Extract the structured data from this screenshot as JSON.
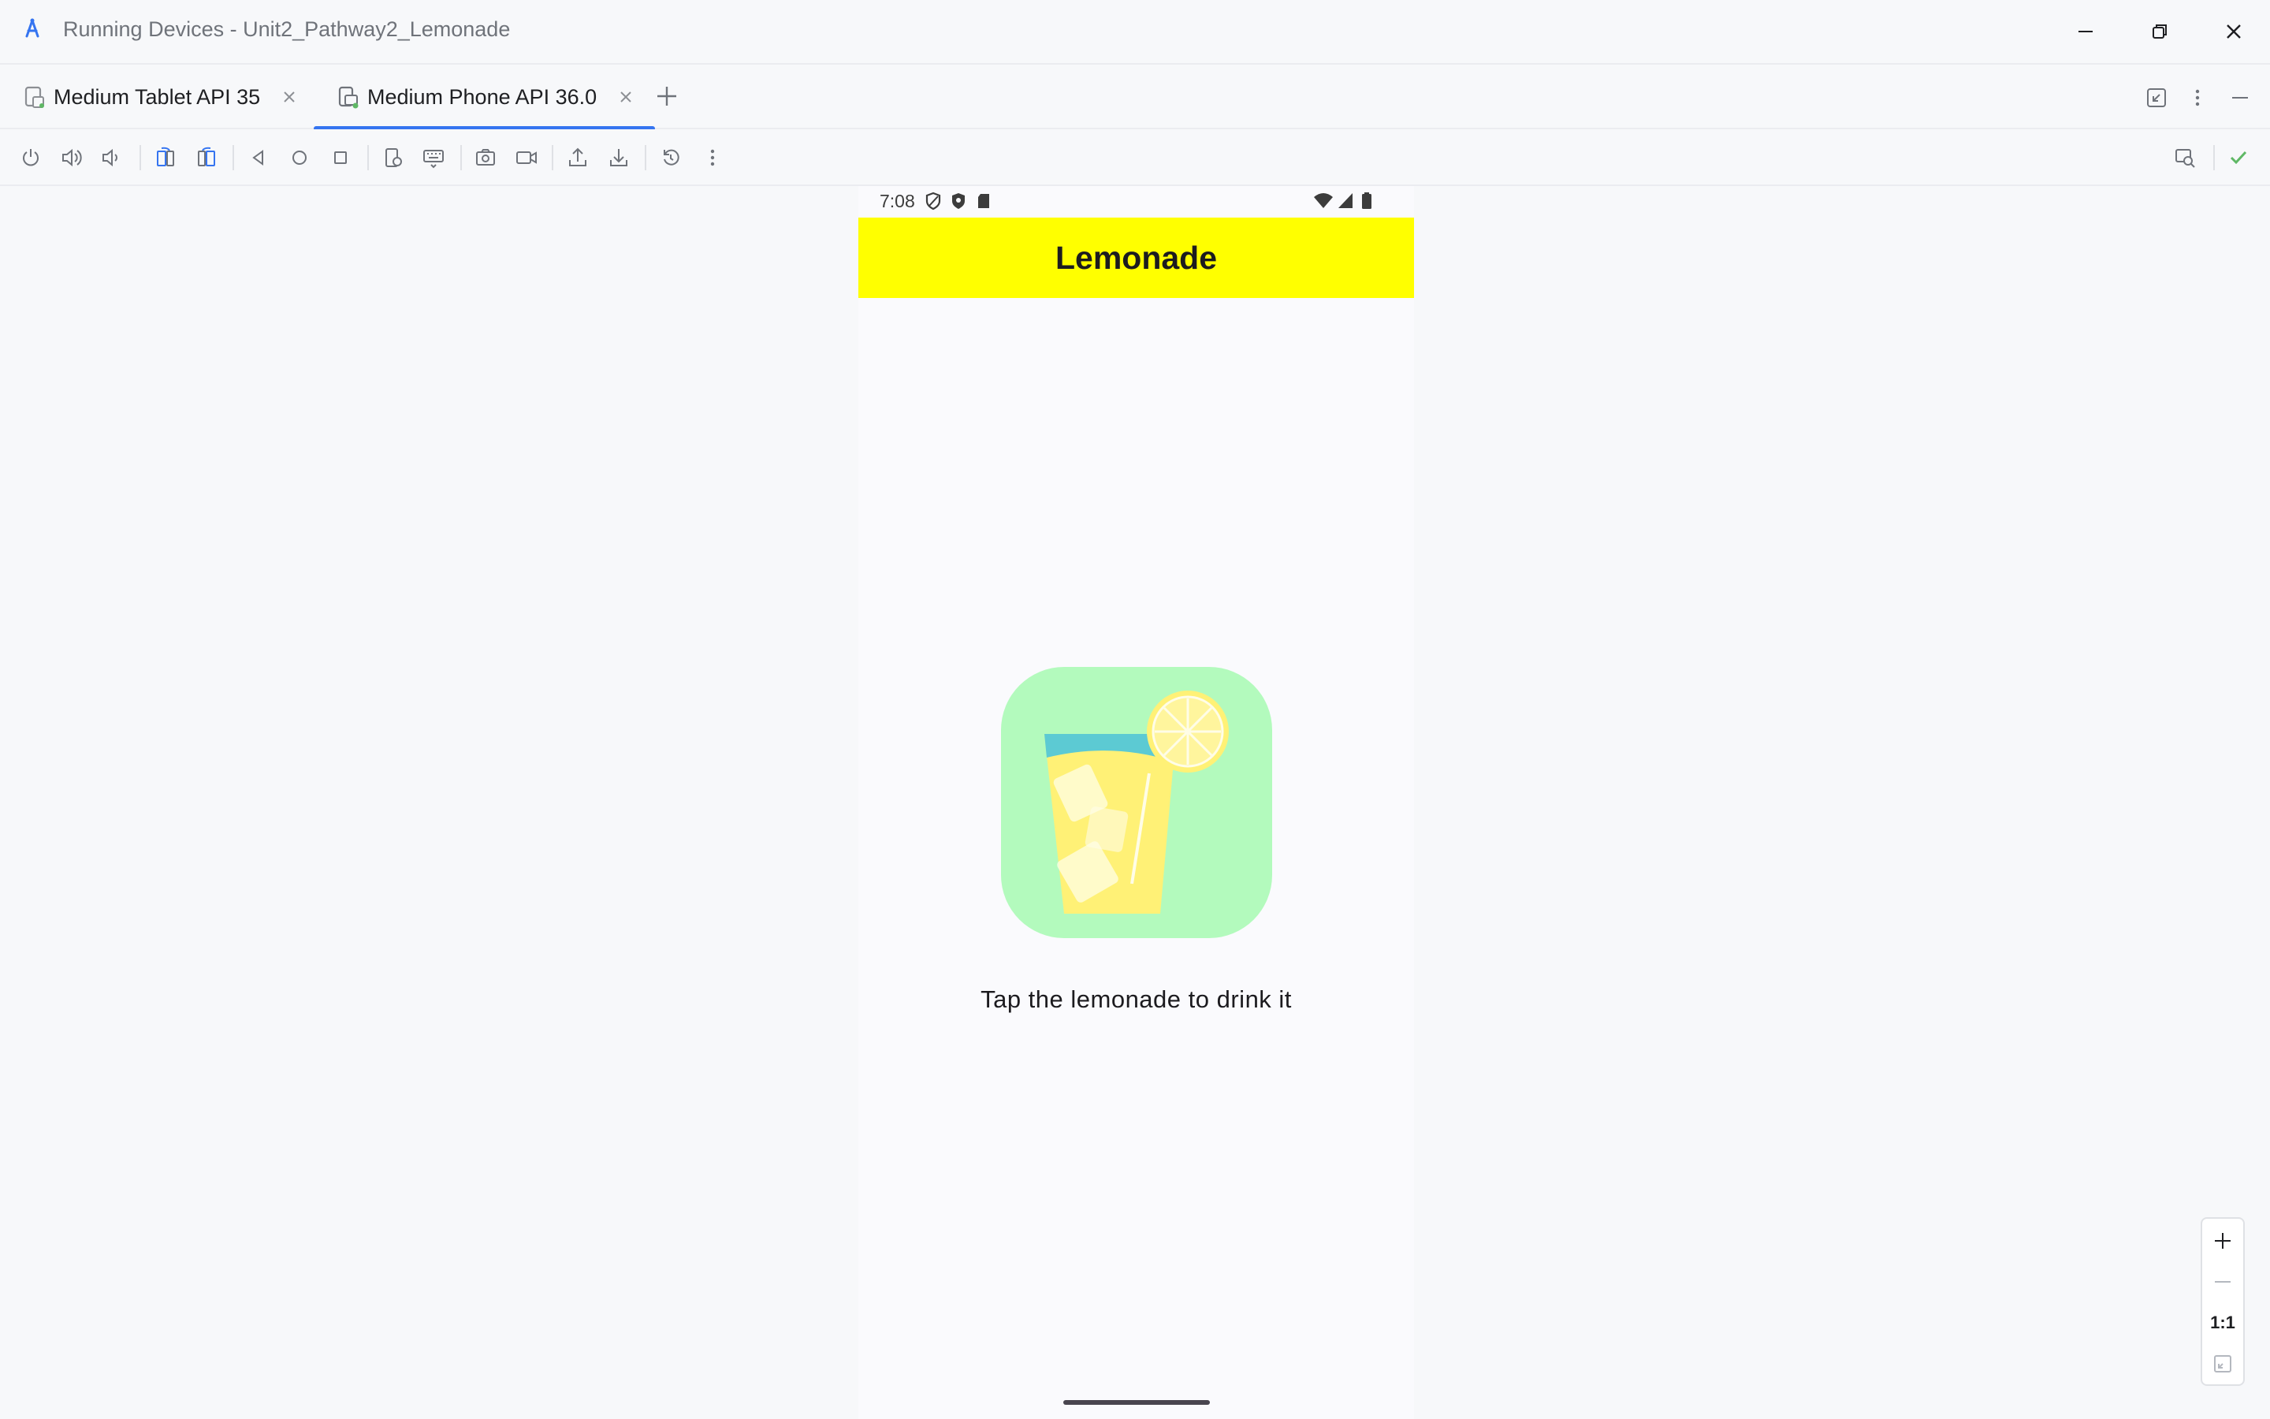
{
  "window": {
    "title": "Running Devices - Unit2_Pathway2_Lemonade",
    "controls": [
      "minimize-icon",
      "restore-icon",
      "close-icon"
    ]
  },
  "tabs": [
    {
      "label": "Medium Tablet API 35",
      "active": false
    },
    {
      "label": "Medium Phone API 36.0",
      "active": true
    }
  ],
  "toolbar": {
    "left_icons": [
      "power-icon",
      "volume-up-icon",
      "volume-down-icon",
      "rotate-left-icon",
      "rotate-right-icon",
      "back-icon",
      "home-icon",
      "overview-icon",
      "snapshot-icon",
      "keyboard-icon",
      "screenshot-icon",
      "screen-record-icon",
      "push-file-icon",
      "pull-file-icon",
      "reset-icon",
      "more-icon"
    ],
    "right_icons": [
      "device-mirror-icon",
      "checkmark-icon"
    ]
  },
  "device": {
    "status": {
      "time": "7:08"
    },
    "app_title": "Lemonade",
    "instruction": "Tap the lemonade to drink it",
    "image_name": "lemonade-glass-icon"
  },
  "zoom": {
    "zoom_in": "+",
    "zoom_out": "—",
    "actual_size": "1:1"
  },
  "colors": {
    "app_bar": "#ffff00",
    "image_bg": "#b3fabd",
    "accent": "#3574f0"
  }
}
